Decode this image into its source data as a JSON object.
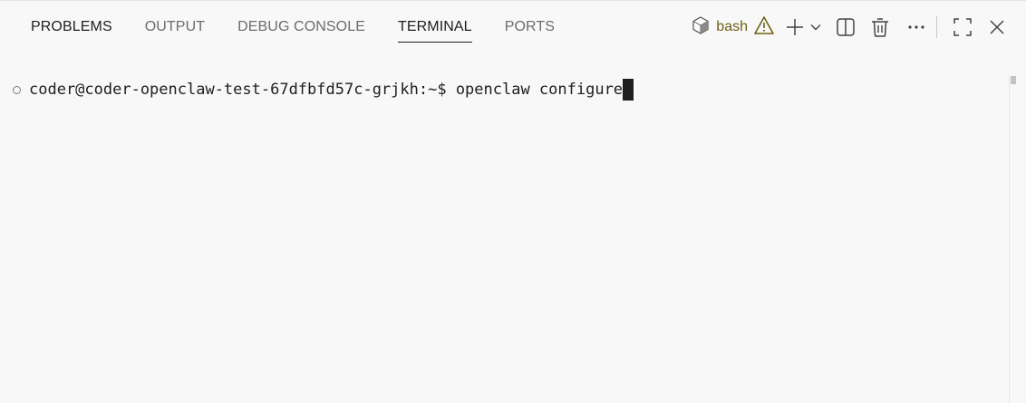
{
  "tabs": [
    {
      "label": "PROBLEMS",
      "active": false
    },
    {
      "label": "OUTPUT",
      "active": false
    },
    {
      "label": "DEBUG CONSOLE",
      "active": false
    },
    {
      "label": "TERMINAL",
      "active": true
    },
    {
      "label": "PORTS",
      "active": false
    }
  ],
  "terminal_instance": {
    "name": "bash",
    "icon": "bash-cube-icon",
    "status_icon": "warning-icon"
  },
  "actions": {
    "new_terminal_icon": "plus-icon",
    "launch_profile_icon": "chevron-down-icon",
    "split_icon": "split-editor-icon",
    "kill_icon": "trash-icon",
    "more_icon": "ellipsis-icon",
    "maximize_icon": "maximize-icon",
    "close_icon": "close-icon"
  },
  "terminal": {
    "prompt": "coder@coder-openclaw-test-67dfbfd57c-grjkh:~$ ",
    "command": "openclaw configure"
  },
  "colors": {
    "background": "#f8f8f8",
    "text": "#1e1e1e",
    "inactive_tab": "#6c6c6c",
    "terminal_name": "#6e6214"
  }
}
